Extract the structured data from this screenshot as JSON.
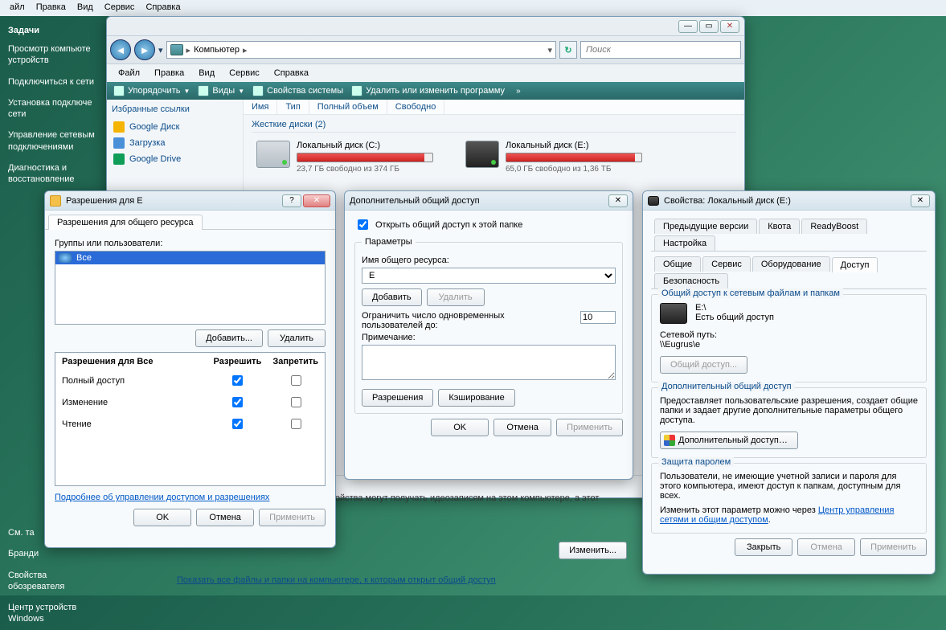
{
  "topmenu": [
    "айл",
    "Правка",
    "Вид",
    "Сервис",
    "Справка"
  ],
  "sidebar": {
    "header": "Задачи",
    "items": [
      "Просмотр компьюте устройств",
      "Подключиться к сети",
      "Установка подключе сети",
      "Управление сетевым подключениями",
      "Диагностика и восстановление"
    ],
    "bottom": [
      "См. та",
      "Бранди",
      "Свойства обозревателя",
      "Центр устройств Windows"
    ]
  },
  "explorer": {
    "location_label": "Компьютер",
    "search_placeholder": "Поиск",
    "menu": [
      "Файл",
      "Правка",
      "Вид",
      "Сервис",
      "Справка"
    ],
    "toolbar": [
      "Упорядочить",
      "Виды",
      "Свойства системы",
      "Удалить или изменить программу"
    ],
    "columns": [
      "Имя",
      "Тип",
      "Полный объем",
      "Свободно"
    ],
    "fav_header": "Избранные ссылки",
    "favorites": [
      {
        "label": "Google Диск",
        "color": "#f4b400"
      },
      {
        "label": "Загрузка",
        "color": "#4a90d9"
      },
      {
        "label": "Google Drive",
        "color": "#0f9d58"
      }
    ],
    "group_header": "Жесткие диски (2)",
    "drives": [
      {
        "name": "Локальный диск (C:)",
        "sub": "23,7 ГБ свободно из 374 ГБ",
        "fill": 94,
        "hdd": false
      },
      {
        "name": "Локальный диск (E:)",
        "sub": "65,0 ГБ свободно из 1,36 ТБ",
        "fill": 95,
        "hdd": true
      }
    ],
    "status_label": "Компьютер",
    "bottom_text": "файлам, сетевые пользователи и устройства могут получать идеозаписям на этом компьютере, а этот компьютер может ого типа в сети.",
    "change_btn": "Изменить...",
    "show_all_link": "Показать все файлы и папки на компьютере, к которым открыт общий доступ"
  },
  "perm": {
    "title": "Разрешения для E",
    "tab": "Разрешения для общего ресурса",
    "groups_label": "Группы или пользователи:",
    "selected_user": "Все",
    "add_btn": "Добавить...",
    "remove_btn": "Удалить",
    "col_header": "Разрешения для Все",
    "col_allow": "Разрешить",
    "col_deny": "Запретить",
    "rows": [
      {
        "label": "Полный доступ",
        "allow": true,
        "deny": false
      },
      {
        "label": "Изменение",
        "allow": true,
        "deny": false
      },
      {
        "label": "Чтение",
        "allow": true,
        "deny": false
      }
    ],
    "learn_link": "Подробнее об управлении доступом и разрешениях",
    "ok": "OK",
    "cancel": "Отмена",
    "apply": "Применить"
  },
  "adv": {
    "title": "Дополнительный общий доступ",
    "open_share": "Открыть общий доступ к этой папке",
    "params_legend": "Параметры",
    "share_name_label": "Имя общего ресурса:",
    "share_name_value": "E",
    "add_btn": "Добавить",
    "del_btn": "Удалить",
    "limit_label": "Ограничить число одновременных пользователей до:",
    "limit_value": 10,
    "note_label": "Примечание:",
    "note_value": "",
    "perm_btn": "Разрешения",
    "cache_btn": "Кэширование",
    "ok": "OK",
    "cancel": "Отмена",
    "apply": "Применить"
  },
  "props": {
    "title": "Свойства: Локальный диск (E:)",
    "tabs_row1": [
      "Предыдущие версии",
      "Квота",
      "ReadyBoost",
      "Настройка"
    ],
    "tabs_row2": [
      "Общие",
      "Сервис",
      "Оборудование",
      "Доступ",
      "Безопасность"
    ],
    "active_tab": "Доступ",
    "net_share_legend": "Общий доступ к сетевым файлам и папкам",
    "drive_label": "E:\\",
    "share_status": "Есть общий доступ",
    "netpath_label": "Сетевой путь:",
    "netpath_value": "\\\\Eugrus\\e",
    "share_btn": "Общий доступ...",
    "adv_legend": "Дополнительный общий доступ",
    "adv_text": "Предоставляет пользовательские разрешения, создает общие папки и задает другие дополнительные параметры общего доступа.",
    "adv_btn": "Дополнительный доступ…",
    "pw_legend": "Защита паролем",
    "pw_text1": "Пользователи, не имеющие учетной записи и пароля для этого компьютера, имеют доступ к папкам, доступным для всех.",
    "pw_text2": "Изменить этот параметр можно через ",
    "pw_link": "Центр управления сетями и общим доступом",
    "close": "Закрыть",
    "cancel": "Отмена",
    "apply": "Применить"
  }
}
